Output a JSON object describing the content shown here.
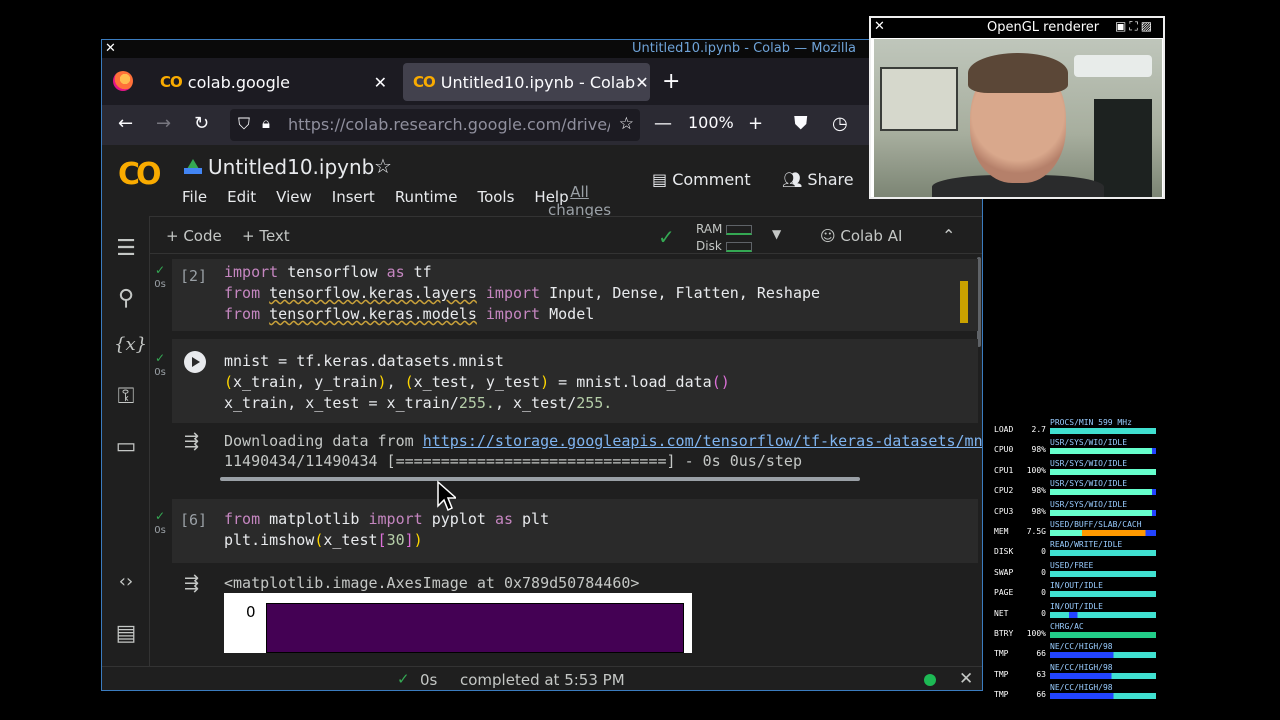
{
  "window": {
    "title": "Untitled10.ipynb - Colab — Mozilla"
  },
  "browser": {
    "tabs": [
      {
        "label": "colab.google",
        "icon": "colab-icon",
        "close": "✕"
      },
      {
        "label": "Untitled10.ipynb - Colab",
        "icon": "colab-icon",
        "close": "✕"
      }
    ],
    "new_tab": "+",
    "url": "https://colab.research.google.com/drive/",
    "zoom": "100%",
    "zoom_minus": "—",
    "zoom_plus": "+"
  },
  "colab": {
    "logo": "CO",
    "notebook_title": "Untitled10.ipynb",
    "menu": [
      "File",
      "Edit",
      "View",
      "Insert",
      "Runtime",
      "Tools",
      "Help"
    ],
    "all_changes": "All changes",
    "comment": "Comment",
    "share": "Share",
    "toolbar": {
      "code": "+ Code",
      "text": "+ Text",
      "ram": "RAM",
      "disk": "Disk",
      "colab_ai": "Colab AI"
    }
  },
  "cells": [
    {
      "exec": "[2]",
      "time": "0s",
      "lines": [
        "import tensorflow as tf",
        "from tensorflow.keras.layers import Input, Dense, Flatten, Reshape",
        "from tensorflow.keras.models import Model"
      ]
    },
    {
      "exec": "",
      "time": "0s",
      "lines": [
        "mnist = tf.keras.datasets.mnist",
        "(x_train, y_train), (x_test, y_test) = mnist.load_data()",
        "x_train, x_test = x_train/255., x_test/255."
      ],
      "output": {
        "line1_prefix": "Downloading data from ",
        "line1_link": "https://storage.googleapis.com/tensorflow/tf-keras-datasets/mnist.npz",
        "line2": "11490434/11490434 [==============================] - 0s 0us/step"
      }
    },
    {
      "exec": "[6]",
      "time": "0s",
      "lines": [
        "from matplotlib import pyplot as plt",
        "plt.imshow(x_test[30])"
      ],
      "output": {
        "line1": "<matplotlib.image.AxesImage at 0x789d50784460>",
        "tick": "0"
      }
    }
  ],
  "status": {
    "check": "✓",
    "seconds": "0s",
    "message": "completed at 5:53 PM",
    "close": "✕"
  },
  "webcam": {
    "title": "OpenGL renderer"
  },
  "monitor": {
    "rows": [
      {
        "k": "LOAD",
        "v": "2.7",
        "h": "PROCS/MIN 599 MHz"
      },
      {
        "k": "CPU0",
        "v": "98%",
        "h": "USR/SYS/WIO/IDLE"
      },
      {
        "k": "CPU1",
        "v": "100%",
        "h": "USR/SYS/WIO/IDLE"
      },
      {
        "k": "CPU2",
        "v": "98%",
        "h": "USR/SYS/WIO/IDLE"
      },
      {
        "k": "CPU3",
        "v": "98%",
        "h": "USR/SYS/WIO/IDLE"
      },
      {
        "k": "MEM",
        "v": "7.5G",
        "h": "USED/BUFF/SLAB/CACH"
      },
      {
        "k": "DISK",
        "v": "0",
        "h": "READ/WRITE/IDLE"
      },
      {
        "k": "SWAP",
        "v": "0",
        "h": "USED/FREE"
      },
      {
        "k": "PAGE",
        "v": "0",
        "h": "IN/OUT/IDLE"
      },
      {
        "k": "NET",
        "v": "0",
        "h": "IN/OUT/IDLE"
      },
      {
        "k": "BTRY",
        "v": "100%",
        "h": "CHRG/AC"
      },
      {
        "k": "TMP",
        "v": "66",
        "h": "NE/CC/HIGH/98"
      },
      {
        "k": "TMP",
        "v": "63",
        "h": "NE/CC/HIGH/98"
      },
      {
        "k": "TMP",
        "v": "66",
        "h": "NE/CC/HIGH/98"
      }
    ]
  }
}
